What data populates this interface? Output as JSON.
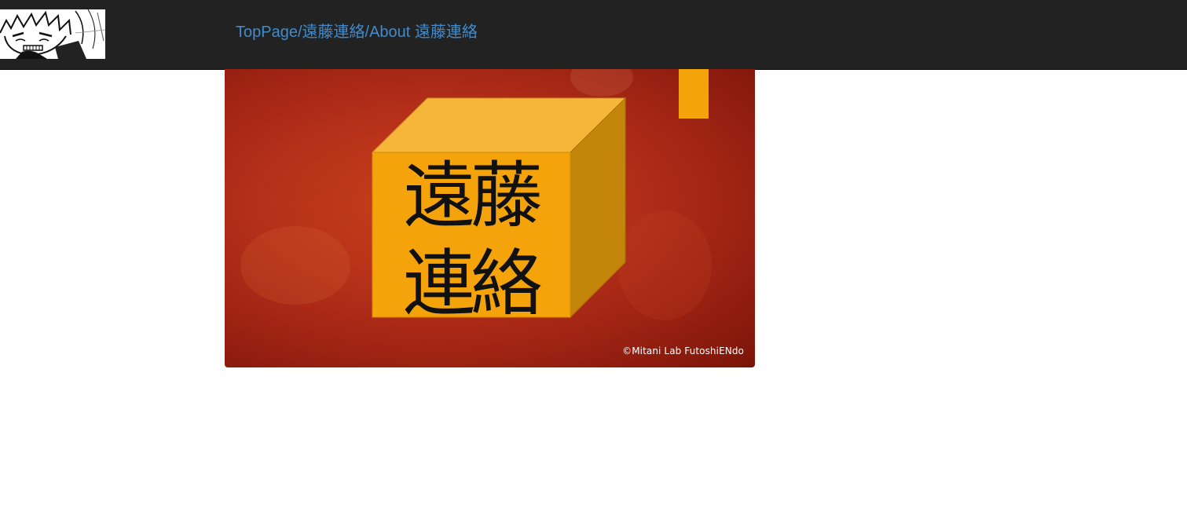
{
  "header": {
    "logo_icon": "manga-character-logo",
    "breadcrumb": {
      "home_label": "TopPage",
      "separator": "/",
      "section_label": "遠藤連絡",
      "current_label": "About 遠藤連絡"
    }
  },
  "banner": {
    "box_line1": "遠藤",
    "box_line2": "連絡",
    "credit": "©Mitani Lab FutoshiENdo",
    "colors": {
      "background": "#b8321a",
      "box_front": "#f4a40a",
      "box_top": "#f6b63a",
      "box_side": "#c4860a",
      "tab": "#f4a40a"
    }
  }
}
